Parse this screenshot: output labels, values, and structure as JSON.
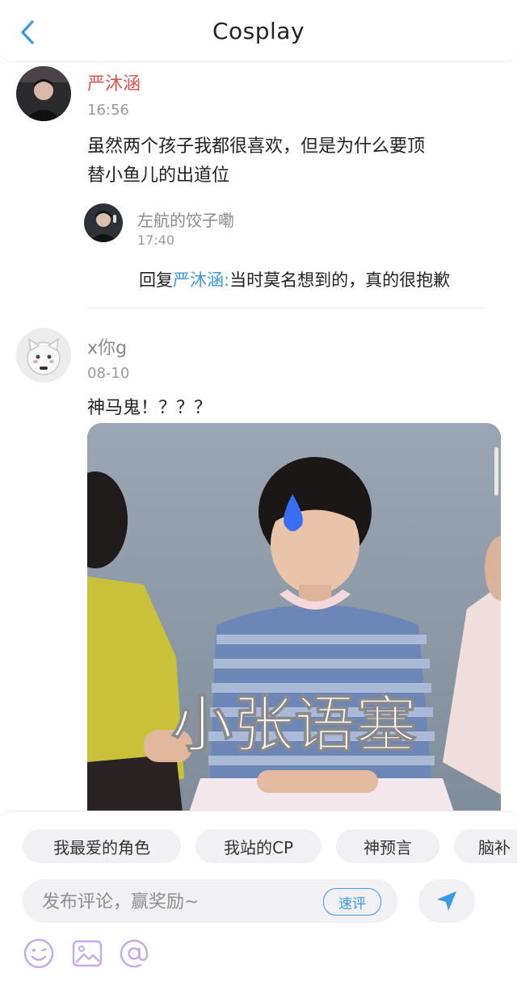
{
  "header": {
    "title": "Cosplay"
  },
  "comments": [
    {
      "author": "严沐涵",
      "time": "16:56",
      "text_line1": "虽然两个孩子我都很喜欢，但是为什么要顶",
      "text_line2": "替小鱼儿的出道位",
      "reply": {
        "author": "左航的饺子嘞",
        "time": "17:40",
        "prefix": "回复",
        "target": "严沐涵",
        "separator": ":",
        "text": "当时莫名想到的，真的很抱歉"
      }
    },
    {
      "author": "x你g",
      "time": "08-10",
      "text": "神马鬼！？？？",
      "image_caption": "小张语塞"
    }
  ],
  "chips": [
    "我最爱的角色",
    "我站的CP",
    "神预言",
    "脑补"
  ],
  "composer": {
    "placeholder": "发布评论，赢奖励~",
    "quick_review": "速评"
  },
  "colors": {
    "accent": "#3a9ae8",
    "author_highlight": "#d9534f",
    "author_gray": "#8a8a8a"
  },
  "icons": [
    "back-arrow-icon",
    "send-icon",
    "emoji-icon",
    "image-icon",
    "mention-icon"
  ]
}
